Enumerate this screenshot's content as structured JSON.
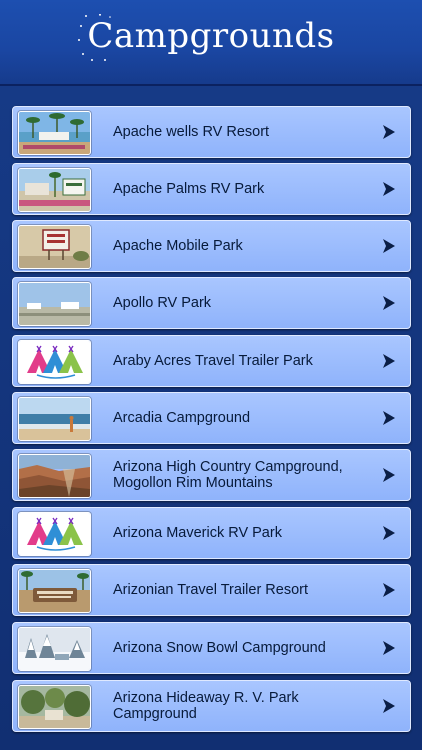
{
  "header": {
    "title": "Campgrounds"
  },
  "campgrounds": [
    {
      "name": "Apache wells RV Resort",
      "thumb": "beach-palms"
    },
    {
      "name": "Apache Palms RV Park",
      "thumb": "palms-sign"
    },
    {
      "name": "Apache Mobile Park",
      "thumb": "park-sign"
    },
    {
      "name": "Apollo RV Park",
      "thumb": "field"
    },
    {
      "name": "Araby Acres Travel Trailer Park",
      "thumb": "tent-logo"
    },
    {
      "name": "Arcadia Campground",
      "thumb": "beach"
    },
    {
      "name": "Arizona High Country Campground, Mogollon Rim Mountains",
      "thumb": "canyon"
    },
    {
      "name": "Arizona Maverick RV Park",
      "thumb": "tent-logo"
    },
    {
      "name": "Arizonian Travel Trailer Resort",
      "thumb": "entrance-sign"
    },
    {
      "name": "Arizona Snow Bowl Campground",
      "thumb": "snow"
    },
    {
      "name": "Arizona Hideaway R. V. Park Campground",
      "thumb": "trees"
    }
  ],
  "icons": {
    "row_arrow": "chevron-right-icon"
  },
  "colors": {
    "header": "#1d4fb0",
    "row": "#a9c6ff",
    "background": "#0f2a6e"
  }
}
